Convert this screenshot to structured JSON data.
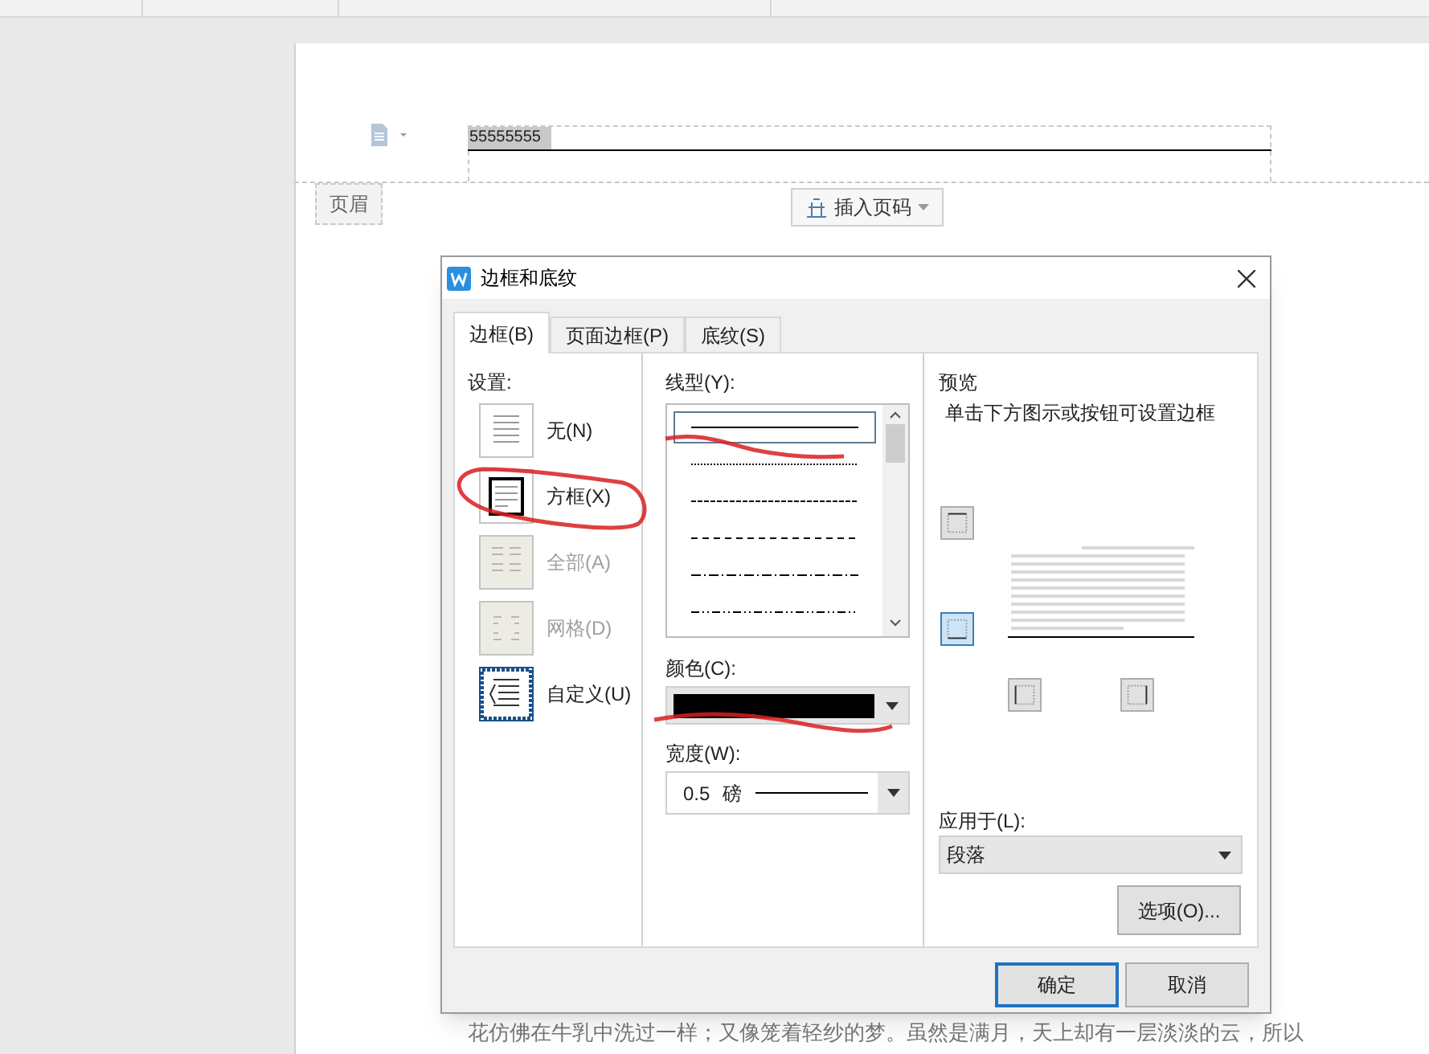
{
  "header": {
    "text": "55555555",
    "label": "页眉",
    "insert_button": "插入页码"
  },
  "dialog": {
    "title": "边框和底纹",
    "tabs": [
      {
        "label": "边框(B)",
        "selected": true
      },
      {
        "label": "页面边框(P)",
        "selected": false
      },
      {
        "label": "底纹(S)",
        "selected": false
      }
    ],
    "settings": {
      "label": "设置:",
      "items": [
        {
          "label": "无(N)",
          "kind": "none",
          "selected": false,
          "disabled": false
        },
        {
          "label": "方框(X)",
          "kind": "box",
          "selected": false,
          "disabled": false
        },
        {
          "label": "全部(A)",
          "kind": "all",
          "selected": false,
          "disabled": true
        },
        {
          "label": "网格(D)",
          "kind": "grid",
          "selected": false,
          "disabled": true
        },
        {
          "label": "自定义(U)",
          "kind": "custom",
          "selected": true,
          "disabled": false
        }
      ]
    },
    "line_style": {
      "label": "线型(Y):",
      "styles": [
        {
          "kind": "solid",
          "selected": true
        },
        {
          "kind": "dotted",
          "selected": false
        },
        {
          "kind": "dashed",
          "selected": false
        },
        {
          "kind": "longdash",
          "selected": false
        },
        {
          "kind": "dashdot",
          "selected": false
        },
        {
          "kind": "dashdotdot",
          "selected": false
        }
      ]
    },
    "color": {
      "label": "颜色(C):"
    },
    "width": {
      "label": "宽度(W):",
      "value": "0.5",
      "unit": "磅"
    },
    "preview": {
      "title": "预览",
      "hint": "单击下方图示或按钮可设置边框",
      "edges": [
        {
          "kind": "top",
          "selected": false
        },
        {
          "kind": "bottom",
          "selected": true
        },
        {
          "kind": "left",
          "selected": false
        },
        {
          "kind": "right",
          "selected": false
        }
      ]
    },
    "apply_to": {
      "label": "应用于(L):",
      "value": "段落"
    },
    "options_button": "选项(O)...",
    "buttons": [
      {
        "label": "确定",
        "default": true
      },
      {
        "label": "取消",
        "default": false
      }
    ]
  },
  "body_text": "花仿佛在牛乳中洗过一样；又像笼着轻纱的梦。虽然是满月，天上却有一层淡淡的云，所以"
}
